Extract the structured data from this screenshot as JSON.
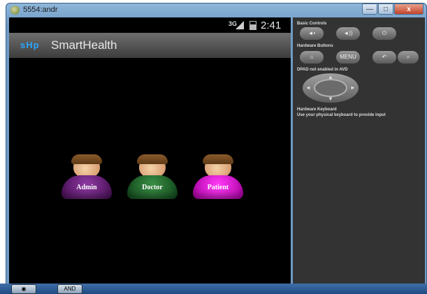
{
  "window": {
    "title": "5554:andr",
    "controls": {
      "minimize": "—",
      "maximize": "□",
      "close": "x"
    }
  },
  "status_bar": {
    "network": "3G",
    "time": "2:41"
  },
  "app_bar": {
    "logo": "sHp",
    "title": "SmartHealth"
  },
  "roles": [
    {
      "label": "Admin",
      "color": "#6a1f7a"
    },
    {
      "label": "Doctor",
      "color": "#1f6a2a"
    },
    {
      "label": "Patient",
      "color": "#e000d8"
    }
  ],
  "emulator_panel": {
    "basic_controls_label": "Basic Controls",
    "hardware_buttons_label": "Hardware Buttons",
    "menu_label": "MENU",
    "dpad_label": "DPAD not enabled in AVD",
    "keyboard_label_1": "Hardware Keyboard",
    "keyboard_label_2": "Use your physical keyboard to provide input",
    "basic_controls": [
      "volume-down-icon",
      "volume-up-icon",
      "power-icon"
    ],
    "hardware_buttons": [
      "home-icon",
      "menu-button",
      "back-icon",
      "search-icon"
    ]
  },
  "taskbar": {
    "app_label": "AND"
  },
  "colors": {
    "accent_logo": "#2aa7ff",
    "panel_bg": "#333333",
    "phone_bg": "#000000"
  }
}
